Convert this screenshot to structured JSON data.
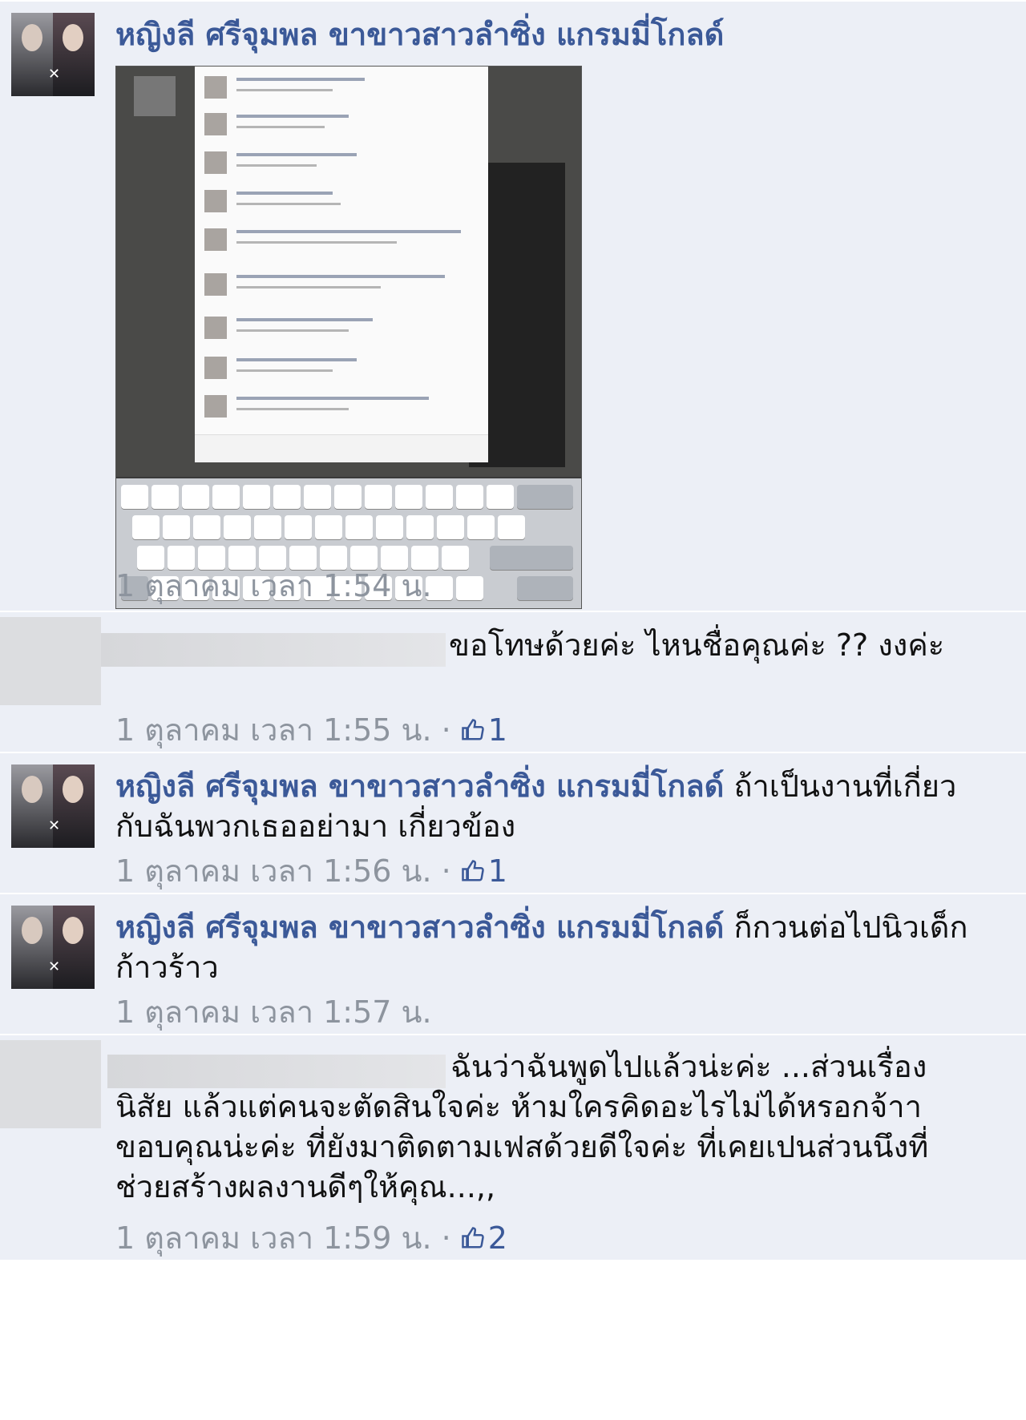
{
  "comments": [
    {
      "author": "หญิงลี ศรีจุมพล ขาขาวสาวลำซิ่ง แกรมมี่โกลด์",
      "text": "",
      "timestamp": "1 ตุลาคม เวลา 1:54 น.",
      "likes": ""
    },
    {
      "author": "",
      "text": "ขอโทษด้วยค่ะ ไหนชื่อคุณค่ะ ?? งงค่ะ",
      "timestamp": "1 ตุลาคม เวลา 1:55 น.",
      "likes": "1"
    },
    {
      "author": "หญิงลี ศรีจุมพล ขาขาวสาวลำซิ่ง แกรมมี่โกลด์",
      "text": "ถ้าเป็นงานที่เกี่ยวกับฉันพวกเธออย่ามา เกี่ยวข้อง",
      "timestamp": "1 ตุลาคม เวลา 1:56 น.",
      "likes": "1"
    },
    {
      "author": "หญิงลี ศรีจุมพล ขาขาวสาวลำซิ่ง แกรมมี่โกลด์",
      "text": "ก็กวนต่อไปนิวเด็กก้าวร้าว",
      "timestamp": "1 ตุลาคม เวลา 1:57 น.",
      "likes": ""
    },
    {
      "author": "",
      "text": "ฉันว่าฉันพูดไปแล้วน่ะค่ะ ...ส่วนเรื่องนิสัย แล้วแต่คนจะตัดสินใจค่ะ ห้ามใครคิดอะไรไม่ได้หรอกจ้าา ขอบคุณน่ะค่ะ ที่ยังมาติดตามเฟสด้วยดีใจค่ะ ที่เคยเปนส่วนนึงที่ช่วยสร้างผลงานดีๆให้คุณ...,,",
      "timestamp": "1 ตุลาคม เวลา 1:59 น.",
      "likes": "2"
    }
  ],
  "separator": "·",
  "icons": {
    "like": "thumbs-up-icon"
  },
  "colors": {
    "name": "#3b5998",
    "meta": "#8d949e",
    "background": "#eceff6"
  }
}
